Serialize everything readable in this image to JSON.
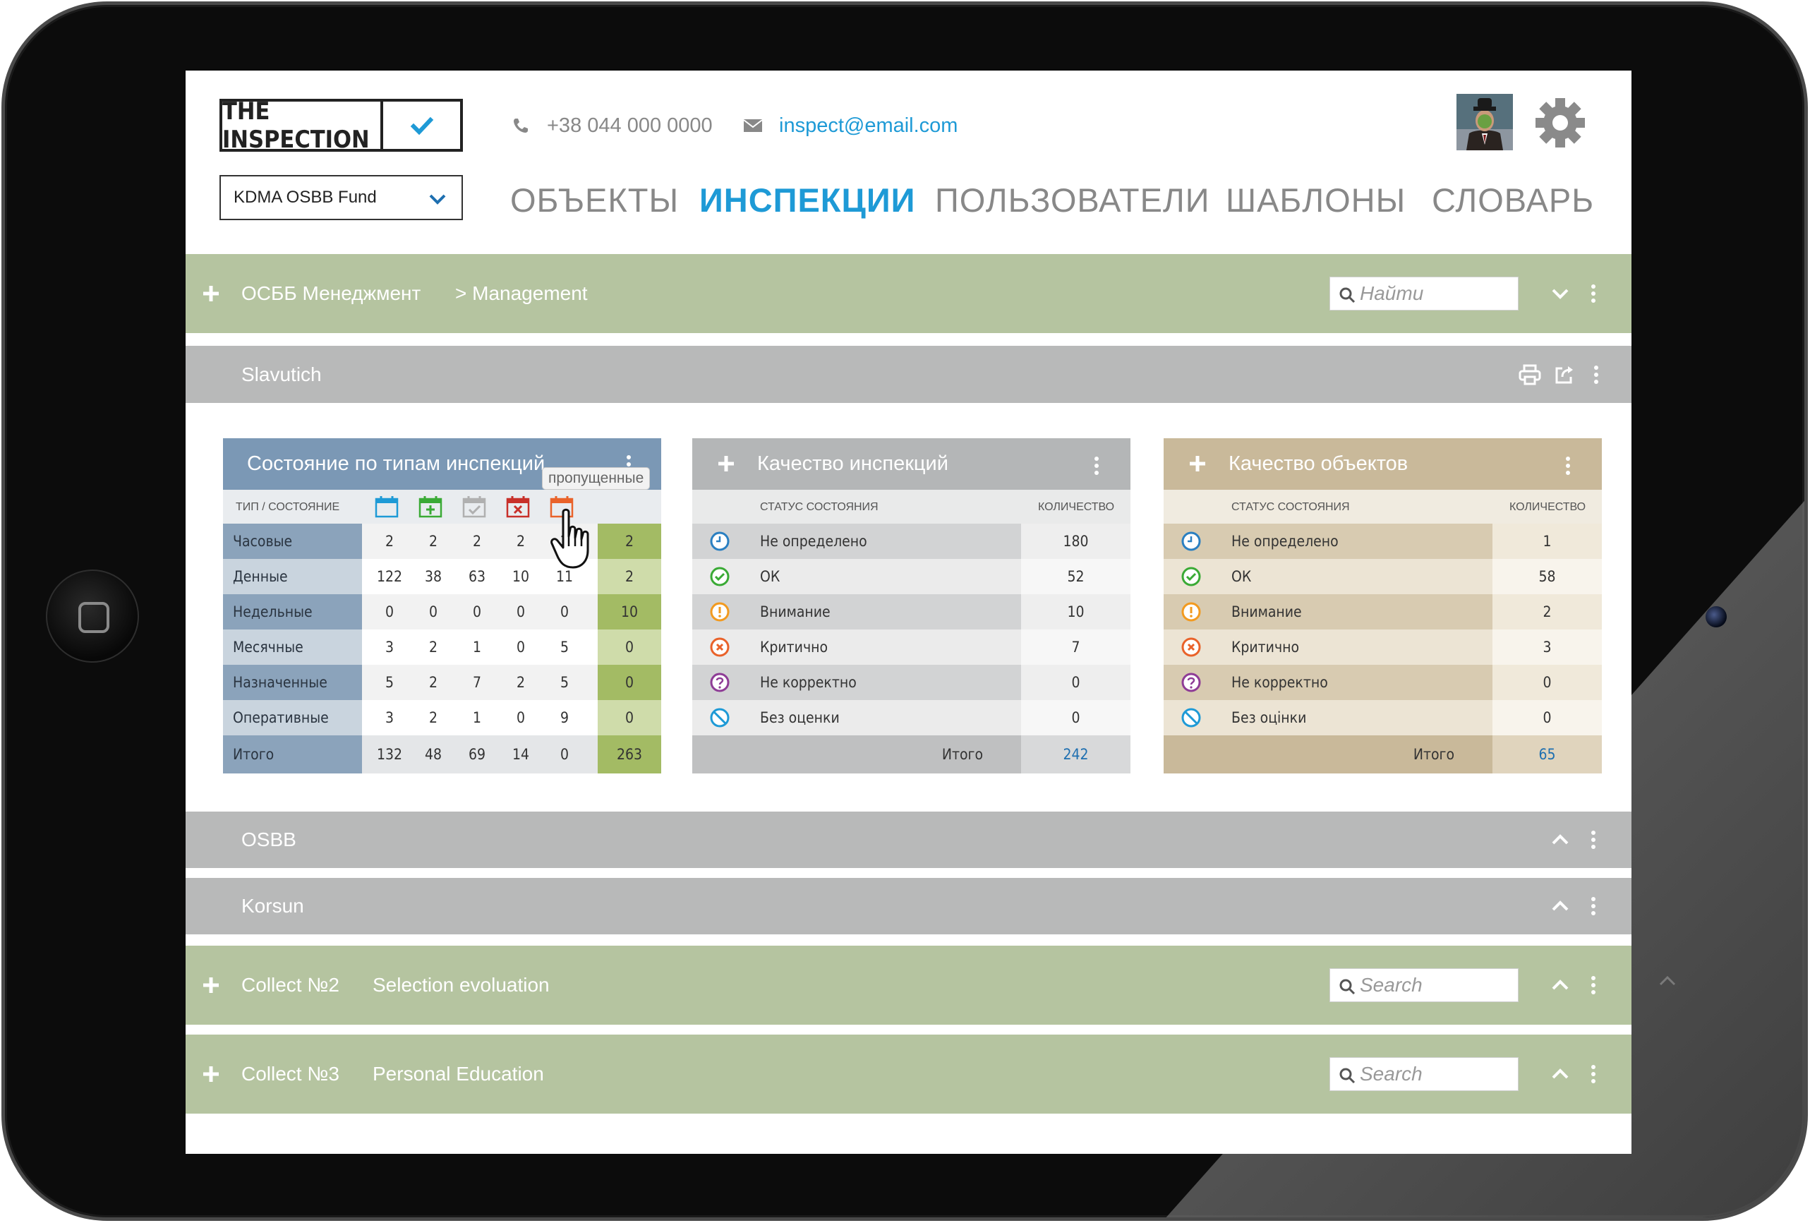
{
  "header": {
    "logo_text": "THE INSPECTION",
    "phone": "+38 044 000 0000",
    "email": "inspect@email.com",
    "fund_select": "KDMA OSBB Fund",
    "nav": [
      {
        "label": "ОБЪЕКТЫ",
        "active": false
      },
      {
        "label": "ИНСПЕКЦИИ",
        "active": true
      },
      {
        "label": "ПОЛЬЗОВАТЕЛИ",
        "active": false
      },
      {
        "label": "ШАБЛОНЫ",
        "active": false
      },
      {
        "label": "СЛОВАРЬ",
        "active": false
      }
    ]
  },
  "group_bar": {
    "title": "ОСББ Менеджмент",
    "breadcrumb": ">  Management",
    "search_placeholder": "Найти"
  },
  "section_slavutich": {
    "title": "Slavutich"
  },
  "panel_types": {
    "title": "Состояние по типам инспекций",
    "col_header": "тип / состояние",
    "tooltip": "пропущенные",
    "rows": [
      {
        "label": "Часовые",
        "values": [
          "2",
          "2",
          "2",
          "2",
          "2"
        ],
        "total": "2"
      },
      {
        "label": "Денные",
        "values": [
          "122",
          "38",
          "63",
          "10",
          "11"
        ],
        "total": "2"
      },
      {
        "label": "Недельные",
        "values": [
          "0",
          "0",
          "0",
          "0",
          "0"
        ],
        "total": "10"
      },
      {
        "label": "Месячные",
        "values": [
          "3",
          "2",
          "1",
          "0",
          "5"
        ],
        "total": "0"
      },
      {
        "label": "Назначенные",
        "values": [
          "5",
          "2",
          "7",
          "2",
          "5"
        ],
        "total": "0"
      },
      {
        "label": "Оперативные",
        "values": [
          "3",
          "2",
          "1",
          "0",
          "9"
        ],
        "total": "0"
      },
      {
        "label": "Итого",
        "values": [
          "132",
          "48",
          "69",
          "14",
          "0"
        ],
        "total": "263"
      }
    ]
  },
  "panel_quality_inspections": {
    "title": "Качество инспекций",
    "status_header": "статус состояния",
    "count_header": "количество",
    "rows": [
      {
        "label": "Не определено",
        "value": "180",
        "icon": "clock-icon"
      },
      {
        "label": "ОК",
        "value": "52",
        "icon": "check-icon"
      },
      {
        "label": "Внимание",
        "value": "10",
        "icon": "warning-icon"
      },
      {
        "label": "Критично",
        "value": "7",
        "icon": "critical-icon"
      },
      {
        "label": "Не корректно",
        "value": "0",
        "icon": "question-icon"
      },
      {
        "label": "Без оценки",
        "value": "0",
        "icon": "no-rating-icon"
      }
    ],
    "total_label": "Итого",
    "total_value": "242"
  },
  "panel_quality_objects": {
    "title": "Качество объектов",
    "status_header": "статус состояния",
    "count_header": "количество",
    "rows": [
      {
        "label": "Не определено",
        "value": "1",
        "icon": "clock-icon"
      },
      {
        "label": "ОК",
        "value": "58",
        "icon": "check-icon"
      },
      {
        "label": "Внимание",
        "value": "2",
        "icon": "warning-icon"
      },
      {
        "label": "Критично",
        "value": "3",
        "icon": "critical-icon"
      },
      {
        "label": "Не корректно",
        "value": "0",
        "icon": "question-icon"
      },
      {
        "label": "Без оцінки",
        "value": "0",
        "icon": "no-rating-icon"
      }
    ],
    "total_label": "Итого",
    "total_value": "65"
  },
  "sections": [
    {
      "title": "OSBB"
    },
    {
      "title": "Korsun"
    }
  ],
  "collections": [
    {
      "title": "Collect №2",
      "subtitle": "Selection evoluation",
      "search_placeholder": "Search"
    },
    {
      "title": "Collect №3",
      "subtitle": "Personal Education",
      "search_placeholder": "Search"
    }
  ],
  "colors": {
    "accent": "#1e9ad6",
    "green_bar": "#b5c4a0",
    "gray_bar": "#b8b9b9",
    "panel_blue": "#7b98b5",
    "panel_tan": "#c9b99a",
    "status_clock": "#2a7fc1",
    "status_ok": "#3aaa35",
    "status_warning": "#f29a1f",
    "status_critical": "#e9622a",
    "status_question": "#8e3c96",
    "status_none": "#1e9ad6"
  }
}
